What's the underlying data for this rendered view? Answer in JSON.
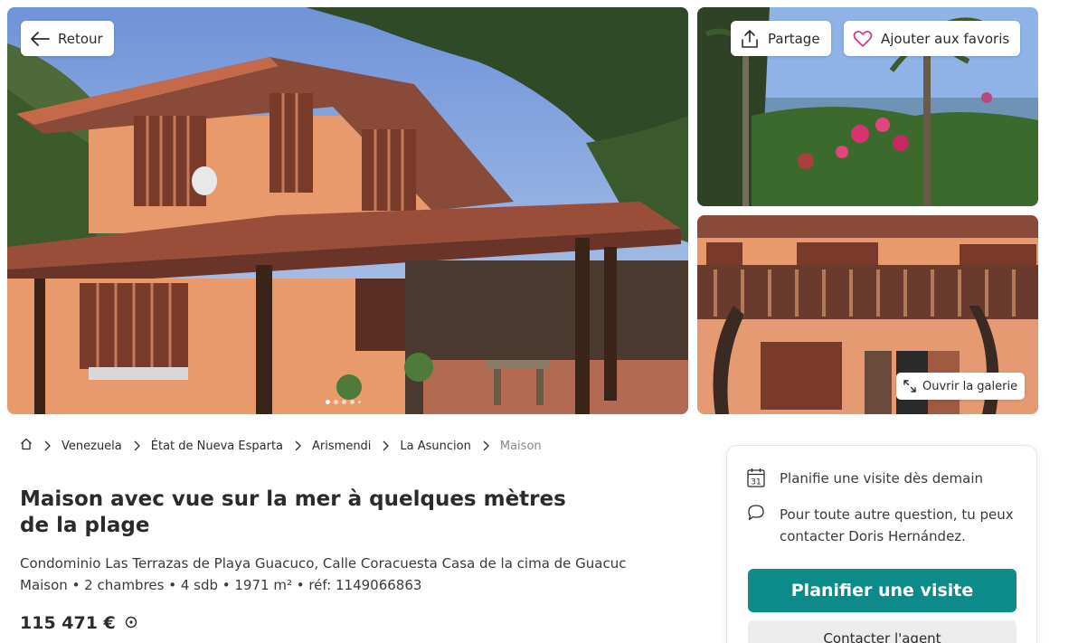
{
  "gallery": {
    "back_label": "Retour",
    "share_label": "Partage",
    "favorite_label": "Ajouter aux favoris",
    "open_gallery_label": "Ouvrir la galerie",
    "slide_indicator": {
      "current": 1,
      "visible_dots": 5
    }
  },
  "breadcrumb": {
    "items": [
      "Venezuela",
      "État de Nueva Esparta",
      "Arismendi",
      "La Asuncion",
      "Maison"
    ]
  },
  "listing": {
    "title": "Maison avec vue sur la mer à quelques mètres de la plage",
    "address": "Condominio Las Terrazas de Playa Guacuco, Calle Coracuesta Casa de la cima de Guacuc",
    "specs": "Maison • 2 chambres • 4 sdb • 1971 m² • réf: 1149066863",
    "price": "115 471 €"
  },
  "contact_card": {
    "visit_text": "Planifie une visite dès demain",
    "calendar_day": "31",
    "question_text": "Pour toute autre question, tu peux contacter Doris Hernández.",
    "primary_button": "Planifier une visite",
    "secondary_button": "Contacter l'agent"
  },
  "colors": {
    "accent": "#0d8a8a",
    "favorite_heart": "#d6338a"
  }
}
